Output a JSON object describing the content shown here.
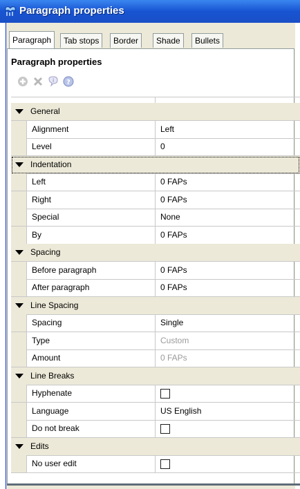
{
  "window": {
    "title": "Paragraph properties"
  },
  "tabs": [
    {
      "label": "Paragraph",
      "active": true
    },
    {
      "label": "Tab stops",
      "active": false
    },
    {
      "label": "Border",
      "active": false
    },
    {
      "label": "Shade",
      "active": false
    },
    {
      "label": "Bullets",
      "active": false
    }
  ],
  "panel": {
    "title": "Paragraph properties"
  },
  "toolbar": [
    {
      "icon": "add-icon"
    },
    {
      "icon": "delete-icon"
    },
    {
      "icon": "info-icon"
    },
    {
      "icon": "help-icon"
    }
  ],
  "grid": {
    "categories": [
      {
        "label": "General",
        "props": [
          {
            "name": "Alignment",
            "value": "Left"
          },
          {
            "name": "Level",
            "value": "0"
          }
        ]
      },
      {
        "label": "Indentation",
        "props": [
          {
            "name": "Left",
            "value": "0 FAPs"
          },
          {
            "name": "Right",
            "value": "0 FAPs"
          },
          {
            "name": "Special",
            "value": "None"
          },
          {
            "name": "By",
            "value": "0 FAPs"
          }
        ]
      },
      {
        "label": "Spacing",
        "props": [
          {
            "name": "Before paragraph",
            "value": "0 FAPs"
          },
          {
            "name": "After paragraph",
            "value": "0 FAPs"
          }
        ]
      },
      {
        "label": "Line Spacing",
        "props": [
          {
            "name": "Spacing",
            "value": "Single"
          },
          {
            "name": "Type",
            "value": "Custom",
            "disabled": true
          },
          {
            "name": "Amount",
            "value": "0 FAPs",
            "disabled": true
          }
        ]
      },
      {
        "label": "Line Breaks",
        "props": [
          {
            "name": "Hyphenate",
            "checkbox": true,
            "checked": false
          },
          {
            "name": "Language",
            "value": "US English"
          },
          {
            "name": "Do not break",
            "checkbox": true,
            "checked": false
          }
        ]
      },
      {
        "label": "Edits",
        "props": [
          {
            "name": "No user edit",
            "checkbox": true,
            "checked": false
          }
        ]
      }
    ]
  },
  "colors": {
    "titlebar": "#1854d2",
    "category_bg": "#ece9d8",
    "disabled_text": "#9a9a9a"
  }
}
